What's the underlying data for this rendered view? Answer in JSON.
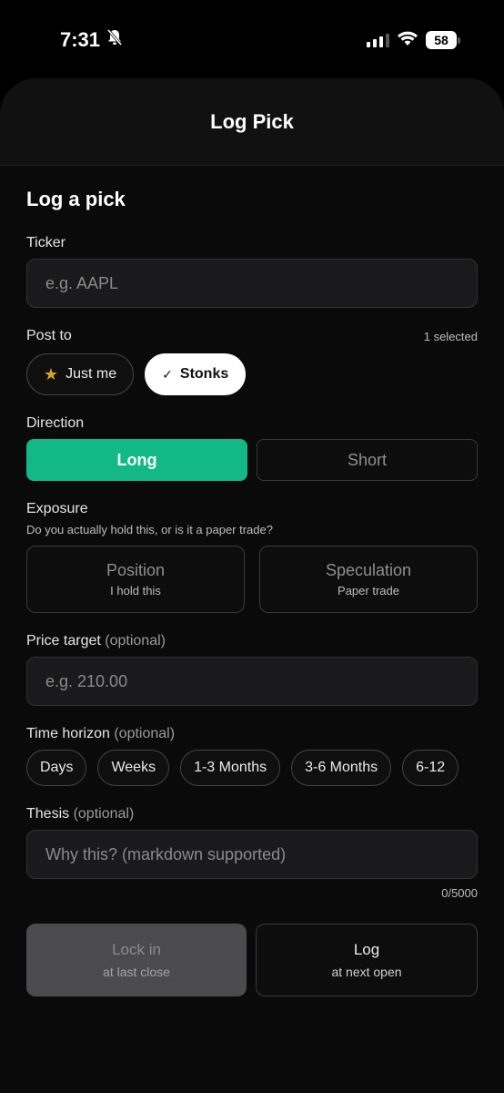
{
  "status": {
    "time": "7:31",
    "battery": "58",
    "icons": [
      "bell-slash-icon",
      "signal-icon",
      "wifi-icon",
      "battery-icon"
    ]
  },
  "sheet": {
    "title": "Log Pick"
  },
  "form": {
    "heading": "Log a pick",
    "ticker": {
      "label": "Ticker",
      "placeholder": "e.g. AAPL"
    },
    "post_to": {
      "label": "Post to",
      "selected_count": "1 selected",
      "options": [
        {
          "label": "Just me",
          "icon": "star-icon",
          "selected": false
        },
        {
          "label": "Stonks",
          "icon": "check-icon",
          "selected": true
        }
      ]
    },
    "direction": {
      "label": "Direction",
      "options": [
        "Long",
        "Short"
      ],
      "active": "Long"
    },
    "exposure": {
      "label": "Exposure",
      "sub": "Do you actually hold this, or is it a paper trade?",
      "options": [
        {
          "title": "Position",
          "sub": "I hold this"
        },
        {
          "title": "Speculation",
          "sub": "Paper trade"
        }
      ]
    },
    "price_target": {
      "label": "Price target",
      "optional": "(optional)",
      "placeholder": "e.g. 210.00"
    },
    "time_horizon": {
      "label": "Time horizon",
      "optional": "(optional)",
      "options": [
        "Days",
        "Weeks",
        "1-3 Months",
        "3-6 Months",
        "6-12"
      ]
    },
    "thesis": {
      "label": "Thesis",
      "optional": "(optional)",
      "placeholder": "Why this? (markdown supported)",
      "counter": "0/5000"
    },
    "actions": {
      "lock_in": {
        "title": "Lock in",
        "sub": "at last close"
      },
      "log": {
        "title": "Log",
        "sub": "at next open"
      }
    }
  },
  "colors": {
    "accent_green": "#12b886",
    "background": "#000000",
    "star": "#d4a32a"
  }
}
